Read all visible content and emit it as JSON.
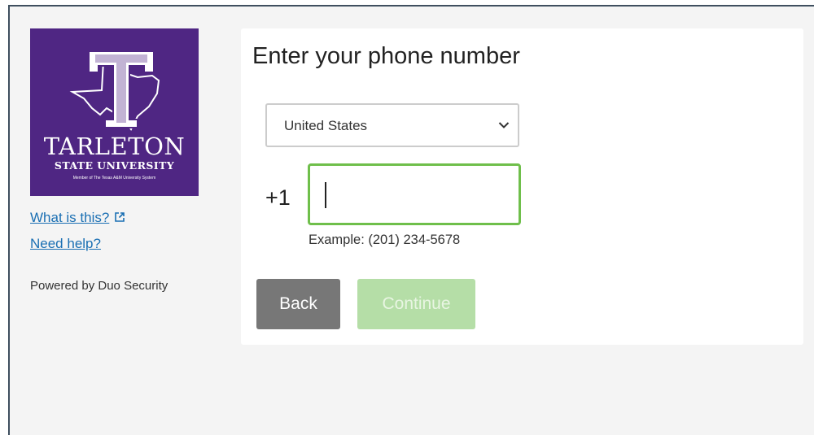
{
  "logo": {
    "line1": "TARLETON",
    "line2": "STATE UNIVERSITY",
    "line3": "Member of The Texas A&M University System",
    "bg_color": "#4f2683"
  },
  "sidebar": {
    "what_is_this": "What is this?",
    "need_help": "Need help?",
    "powered_by": "Powered by Duo Security"
  },
  "form": {
    "title": "Enter your phone number",
    "country_selected": "United States",
    "country_code": "+1",
    "phone_value": "",
    "example": "Example: (201) 234-5678"
  },
  "buttons": {
    "back": "Back",
    "continue": "Continue"
  },
  "icons": {
    "external_link": "external-link-icon",
    "dropdown": "chevron-down-icon"
  },
  "colors": {
    "accent_green": "#6fbf4b",
    "continue_disabled": "#b5dea7",
    "back_gray": "#777777",
    "link_blue": "#1a6fb3"
  }
}
